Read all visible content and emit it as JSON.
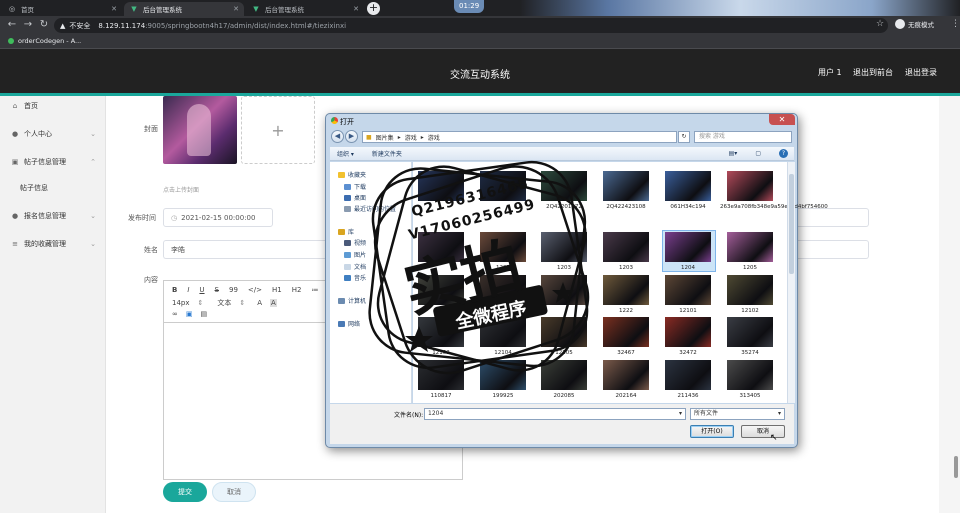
{
  "browser": {
    "tabs": [
      {
        "label": "首页",
        "active": false
      },
      {
        "label": "后台管理系统",
        "active": true
      },
      {
        "label": "后台管理系统",
        "active": false
      }
    ],
    "clock": "01:29",
    "security_label": "不安全",
    "url_host": "8.129.11.174",
    "url_path": ":9005/springbootn4h17/admin/dist/index.html#/tiezixinxi",
    "profile_label": "无痕模式",
    "bookmark": "orderCodegen - A..."
  },
  "app": {
    "title": "交流互动系统",
    "header_links": [
      "用户 1",
      "退出到前台",
      "退出登录"
    ],
    "accent_color": "#1aa79b"
  },
  "sidebar": {
    "items": [
      {
        "label": "首页",
        "icon": "home-icon"
      },
      {
        "label": "个人中心",
        "icon": "user-icon",
        "expandable": true
      },
      {
        "label": "帖子信息管理",
        "icon": "document-icon",
        "expandable": true,
        "expanded": true
      },
      {
        "label": "帖子信息",
        "sub": true
      },
      {
        "label": "报名信息管理",
        "icon": "user-icon",
        "expandable": true
      },
      {
        "label": "我的收藏管理",
        "icon": "list-icon",
        "expandable": true
      }
    ]
  },
  "form": {
    "cover_label": "封面",
    "upload_hint": "点击上传封面",
    "publish_time_label": "发布时间",
    "publish_time_value": "2021-02-15 00:00:00",
    "name_label": "姓名",
    "name_value": "李皓",
    "content_label": "内容",
    "editor_toolbar_row1": [
      "B",
      "I",
      "U",
      "S",
      "99",
      "</>",
      "H1",
      "H2",
      "≔",
      "≡"
    ],
    "editor_font_size": "14px",
    "editor_font_type": "文本",
    "submit_label": "提交",
    "cancel_label": "取消"
  },
  "dialog": {
    "title": "打开",
    "breadcrumb": [
      "图片集",
      "游戏",
      "游戏"
    ],
    "search_placeholder": "搜索 游戏",
    "toolbar": [
      "组织 ▾",
      "新建文件夹"
    ],
    "nav": [
      "收藏夹",
      "下载",
      "桌面",
      "最近访问的位置",
      "库",
      "视频",
      "图片",
      "文档",
      "音乐",
      "计算机",
      "网络"
    ],
    "files": [
      {
        "name": "",
        "color": "#25355a"
      },
      {
        "name": "",
        "color": "#1e2b44"
      },
      {
        "name": "2Q42201072",
        "color": "#2d4a3c"
      },
      {
        "name": "2Q422423108",
        "color": "#4b6a93"
      },
      {
        "name": "061H34c194",
        "color": "#3a5f9c"
      },
      {
        "name": "263e9a708fb348e9a59e2cd4bf754600",
        "color": "#b24a5a"
      },
      {
        "name": "",
        "color": "#3b3040"
      },
      {
        "name": "1203",
        "color": "#6b4a3a"
      },
      {
        "name": "1203",
        "color": "#5a6070"
      },
      {
        "name": "1203",
        "color": "#4a3a4a"
      },
      {
        "name": "1204",
        "color": "#7a3f8f"
      },
      {
        "name": "1205",
        "color": "#a45e9a"
      },
      {
        "name": "1206",
        "color": "#40423a"
      },
      {
        "name": "",
        "color": "#3a2f2a"
      },
      {
        "name": "",
        "color": "#57463c"
      },
      {
        "name": "1222",
        "color": "#6f5a3b"
      },
      {
        "name": "12101",
        "color": "#5d4736"
      },
      {
        "name": "12102",
        "color": "#4f4a33"
      },
      {
        "name": "12103",
        "color": "#34383d"
      },
      {
        "name": "12104",
        "color": "#2d2f33"
      },
      {
        "name": "12105",
        "color": "#4a3b2a"
      },
      {
        "name": "32467",
        "color": "#7a3020"
      },
      {
        "name": "32472",
        "color": "#8a2b24"
      },
      {
        "name": "35274",
        "color": "#3a3d44"
      },
      {
        "name": "110817",
        "color": "#2a2c30"
      },
      {
        "name": "199925",
        "color": "#2d4e6b"
      },
      {
        "name": "202085",
        "color": "#3b3f38"
      },
      {
        "name": "202164",
        "color": "#7a5a4a"
      },
      {
        "name": "211436",
        "color": "#2b3340"
      },
      {
        "name": "313405",
        "color": "#4b4b4b"
      }
    ],
    "selected_index": 10,
    "filename_label": "文件名(N):",
    "filename_value": "1204",
    "filetype_value": "所有文件",
    "open_label": "打开(O)",
    "cancel_label": "取消"
  },
  "watermark": {
    "line1": "Q2196316465",
    "line2": "V17060256499",
    "big": "实拍",
    "banner": "全微程序"
  }
}
